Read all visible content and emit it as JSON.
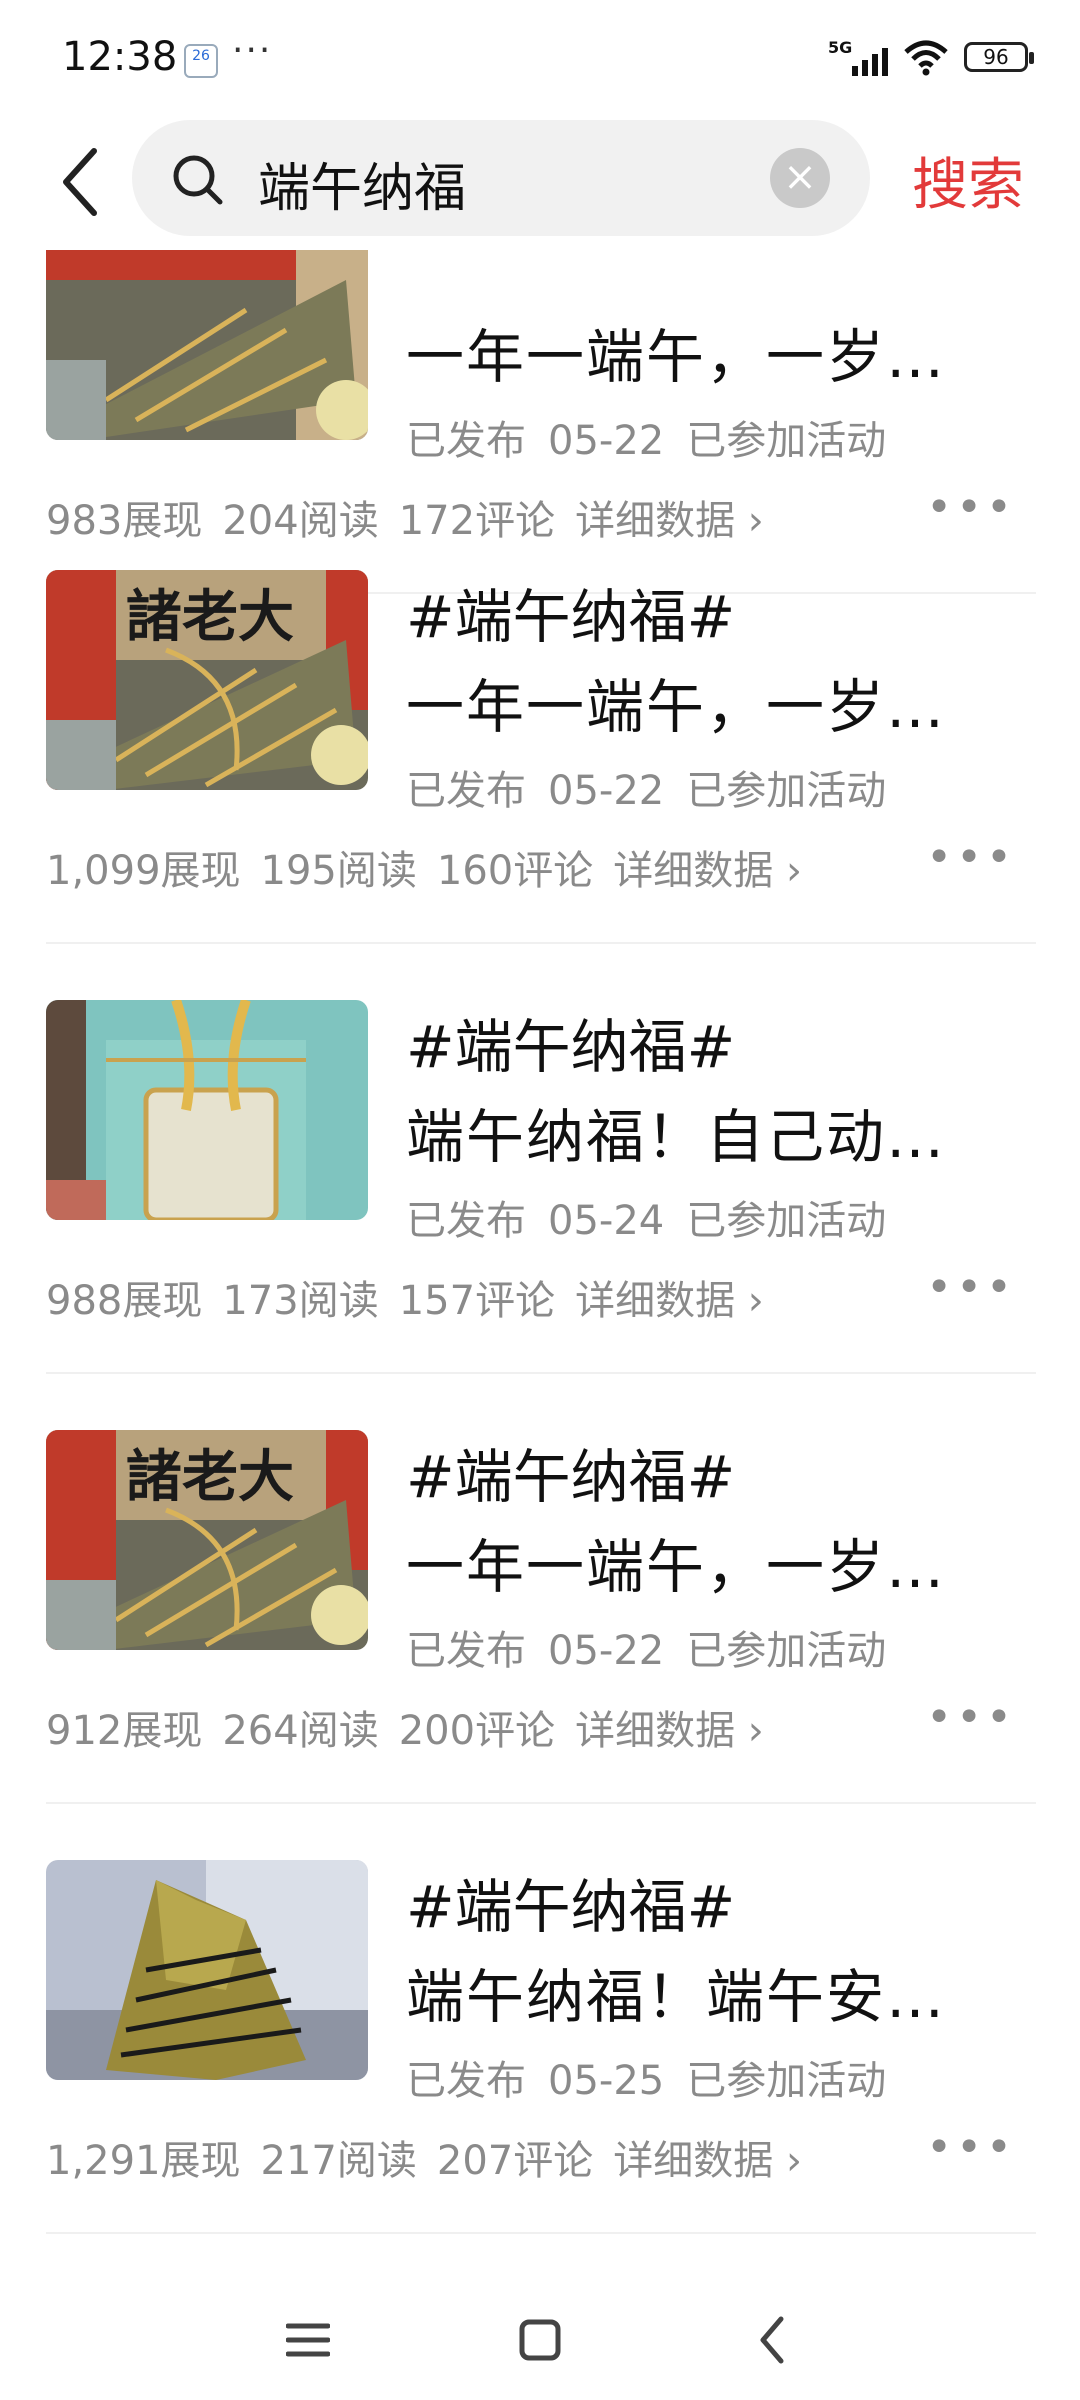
{
  "status_bar": {
    "time": "12:38",
    "calendar_day": "26",
    "more": "···",
    "network": "5G",
    "battery": "96"
  },
  "search": {
    "query": "端午纳福",
    "clear_icon": "×",
    "button_label": "搜索"
  },
  "items": [
    {
      "title1": "",
      "title2": "一年一端午，一岁…",
      "status": "已发布",
      "date": "05-22",
      "activity": "已参加活动",
      "views": "983展现",
      "reads": "204阅读",
      "comments": "172评论",
      "detail": "详细数据 ›",
      "thumb": "zongzi-gift"
    },
    {
      "title1": "#端午纳福#",
      "title2": "一年一端午，一岁…",
      "status": "已发布",
      "date": "05-22",
      "activity": "已参加活动",
      "views": "1,099展现",
      "reads": "195阅读",
      "comments": "160评论",
      "detail": "详细数据 ›",
      "thumb": "zongzi-gift"
    },
    {
      "title1": "#端午纳福#",
      "title2": "端午纳福！自己动…",
      "status": "已发布",
      "date": "05-24",
      "activity": "已参加活动",
      "views": "988展现",
      "reads": "173阅读",
      "comments": "157评论",
      "detail": "详细数据 ›",
      "thumb": "gift-box"
    },
    {
      "title1": "#端午纳福#",
      "title2": "一年一端午，一岁…",
      "status": "已发布",
      "date": "05-22",
      "activity": "已参加活动",
      "views": "912展现",
      "reads": "264阅读",
      "comments": "200评论",
      "detail": "详细数据 ›",
      "thumb": "zongzi-gift"
    },
    {
      "title1": "#端午纳福#",
      "title2": "端午纳福！端午安…",
      "status": "已发布",
      "date": "05-25",
      "activity": "已参加活动",
      "views": "1,291展现",
      "reads": "217阅读",
      "comments": "207评论",
      "detail": "详细数据 ›",
      "thumb": "zongzi"
    }
  ],
  "thumb_text": {
    "brand": "諸老大"
  },
  "more_icon": "•••",
  "colors": {
    "accent": "#e23a3a",
    "meta": "#8a8a8a"
  }
}
